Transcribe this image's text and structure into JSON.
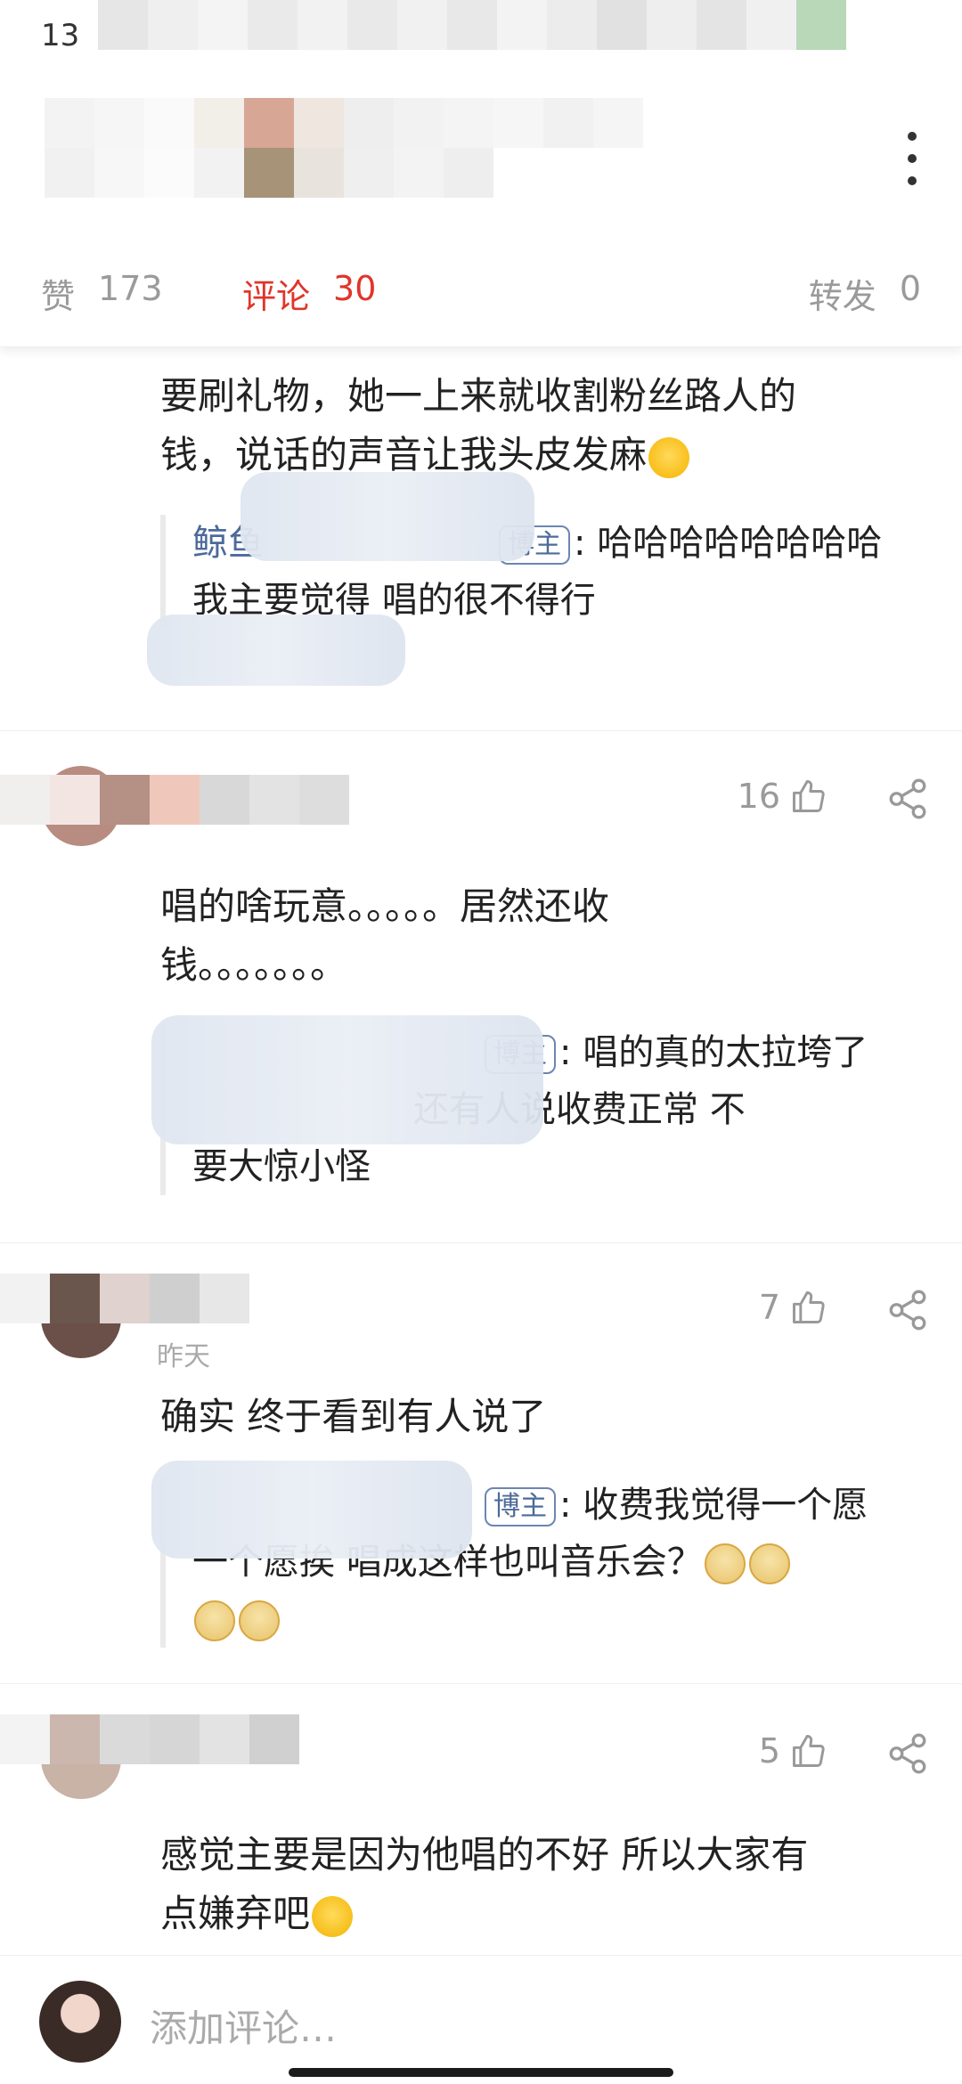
{
  "status_bar": {
    "time": "13"
  },
  "tabs": [
    {
      "label": "赞",
      "count": "173",
      "active": false
    },
    {
      "label": "评论",
      "count": "30",
      "active": true
    },
    {
      "label": "转发",
      "count": "0",
      "active": false
    }
  ],
  "comments": [
    {
      "text_line1": "要刷礼物，她一上来就收割粉丝路人的",
      "text_line2": "钱，说话的声音让我头皮发麻",
      "reply": {
        "name_prefix": "鲸鱼",
        "badge": "博主",
        "text_line1": ": 哈哈哈哈哈哈哈哈",
        "text_line2": "我主要觉得 唱的很不得行"
      }
    },
    {
      "likes": "16",
      "text_line1": "唱的啥玩意。。。。。居然还收",
      "text_line2": "钱。。。。。。。",
      "reply": {
        "badge": "博主",
        "text_line1": ": 唱的真的太拉垮了",
        "text_line2": "还有人说收费正常 不",
        "text_line3": "要大惊小怪"
      }
    },
    {
      "likes": "7",
      "time": "昨天",
      "text_line1": "确实 终于看到有人说了",
      "reply": {
        "badge": "博主",
        "text_line1": ": 收费我觉得一个愿",
        "text_line2": "一个愿挨 唱成这样也叫音乐会？"
      }
    },
    {
      "likes": "5",
      "text_line1": "感觉主要是因为他唱的不好 所以大家有",
      "text_line2": "点嫌弃吧"
    }
  ],
  "composer": {
    "placeholder": "添加评论…"
  },
  "icons": {
    "more": "more-vertical-icon",
    "like": "thumbs-up-icon",
    "share": "share-icon"
  },
  "colors": {
    "accent": "#e0352b",
    "link": "#4d6a9a"
  }
}
